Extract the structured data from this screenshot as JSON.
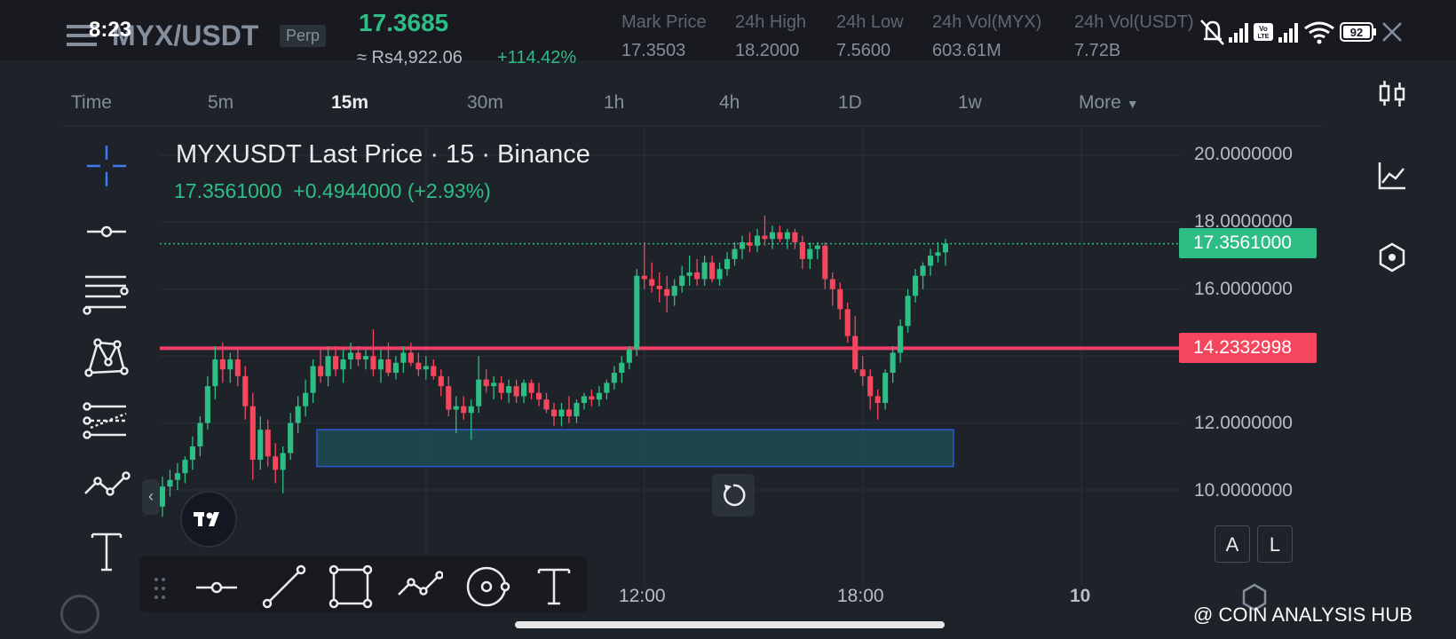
{
  "status_bar": {
    "time": "8:23",
    "battery": "92",
    "network_badge": "Vo LTE"
  },
  "header": {
    "pair": "MYX/USDT",
    "contract_type": "Perp",
    "last_price": "17.3685",
    "price_inr": "≈ Rs4,922.06",
    "change_24h": "+114.42%",
    "stats": [
      {
        "label": "Mark Price",
        "value": "17.3503"
      },
      {
        "label": "24h High",
        "value": "18.2000"
      },
      {
        "label": "24h Low",
        "value": "7.5600"
      },
      {
        "label": "24h Vol(MYX)",
        "value": "603.61M"
      },
      {
        "label": "24h Vol(USDT)",
        "value": "7.72B"
      }
    ]
  },
  "timeframes": {
    "items": [
      "Time",
      "5m",
      "15m",
      "30m",
      "1h",
      "4h",
      "1D",
      "1w",
      "More"
    ],
    "active": "15m"
  },
  "chart": {
    "title": "MYXUSDT Last Price · 15 · Binance",
    "last_value": "17.3561000",
    "change": "+0.4944000 (+2.93%)",
    "y_ticks": [
      "20.0000000",
      "18.0000000",
      "16.0000000",
      "12.0000000",
      "10.0000000"
    ],
    "x_ticks": [
      "12:00",
      "18:00",
      "10"
    ],
    "current_price_label": "17.3561000",
    "horizontal_line_label": "14.2332998",
    "scale_buttons": {
      "auto": "A",
      "log": "L"
    },
    "colors": {
      "up": "#2ebd85",
      "down": "#f6465d",
      "line": "#f23f6a",
      "zone": "#1f4a55",
      "zone_border": "#2c5bd6"
    }
  },
  "watermark": "@ COIN ANALYSIS HUB",
  "chart_data": {
    "type": "candlestick",
    "title": "MYXUSDT Last Price · 15 · Binance",
    "ylim": [
      9.0,
      20.5
    ],
    "horizontal_line": 14.2332998,
    "last_price": 17.3561,
    "zone": {
      "y_low": 10.7,
      "y_high": 11.8
    },
    "candles": [
      {
        "o": 9.5,
        "h": 10.4,
        "l": 9.2,
        "c": 10.1
      },
      {
        "o": 10.1,
        "h": 10.6,
        "l": 9.8,
        "c": 10.3
      },
      {
        "o": 10.3,
        "h": 10.8,
        "l": 10.0,
        "c": 10.5
      },
      {
        "o": 10.5,
        "h": 11.0,
        "l": 10.2,
        "c": 10.9
      },
      {
        "o": 10.9,
        "h": 11.6,
        "l": 10.6,
        "c": 11.3
      },
      {
        "o": 11.3,
        "h": 12.2,
        "l": 11.0,
        "c": 12.0
      },
      {
        "o": 12.0,
        "h": 13.4,
        "l": 11.8,
        "c": 13.1
      },
      {
        "o": 13.1,
        "h": 14.3,
        "l": 12.7,
        "c": 13.9
      },
      {
        "o": 13.9,
        "h": 14.4,
        "l": 13.2,
        "c": 13.6
      },
      {
        "o": 13.6,
        "h": 14.1,
        "l": 13.2,
        "c": 13.9
      },
      {
        "o": 13.9,
        "h": 14.2,
        "l": 13.1,
        "c": 13.4
      },
      {
        "o": 13.4,
        "h": 13.7,
        "l": 12.1,
        "c": 12.5
      },
      {
        "o": 12.5,
        "h": 12.9,
        "l": 10.3,
        "c": 10.9
      },
      {
        "o": 10.9,
        "h": 12.2,
        "l": 10.6,
        "c": 11.8
      },
      {
        "o": 11.8,
        "h": 12.1,
        "l": 10.7,
        "c": 11.0
      },
      {
        "o": 11.0,
        "h": 11.4,
        "l": 10.2,
        "c": 10.6
      },
      {
        "o": 10.6,
        "h": 11.3,
        "l": 9.9,
        "c": 11.1
      },
      {
        "o": 11.1,
        "h": 12.3,
        "l": 10.9,
        "c": 12.0
      },
      {
        "o": 12.0,
        "h": 12.8,
        "l": 11.7,
        "c": 12.5
      },
      {
        "o": 12.5,
        "h": 13.3,
        "l": 12.2,
        "c": 12.9
      },
      {
        "o": 12.9,
        "h": 13.9,
        "l": 12.6,
        "c": 13.7
      },
      {
        "o": 13.7,
        "h": 14.2,
        "l": 13.2,
        "c": 13.4
      },
      {
        "o": 13.4,
        "h": 14.3,
        "l": 13.1,
        "c": 14.0
      },
      {
        "o": 14.0,
        "h": 14.3,
        "l": 13.4,
        "c": 13.6
      },
      {
        "o": 13.6,
        "h": 14.2,
        "l": 13.2,
        "c": 13.9
      },
      {
        "o": 13.9,
        "h": 14.4,
        "l": 13.6,
        "c": 14.1
      },
      {
        "o": 14.1,
        "h": 14.3,
        "l": 13.7,
        "c": 13.9
      },
      {
        "o": 13.9,
        "h": 14.2,
        "l": 13.6,
        "c": 14.0
      },
      {
        "o": 14.0,
        "h": 14.8,
        "l": 13.4,
        "c": 13.6
      },
      {
        "o": 13.6,
        "h": 14.2,
        "l": 13.2,
        "c": 13.9
      },
      {
        "o": 13.9,
        "h": 14.4,
        "l": 13.4,
        "c": 13.5
      },
      {
        "o": 13.5,
        "h": 14.0,
        "l": 13.3,
        "c": 13.8
      },
      {
        "o": 13.8,
        "h": 14.3,
        "l": 13.5,
        "c": 14.1
      },
      {
        "o": 14.1,
        "h": 14.4,
        "l": 13.7,
        "c": 13.8
      },
      {
        "o": 13.8,
        "h": 14.1,
        "l": 13.4,
        "c": 13.6
      },
      {
        "o": 13.6,
        "h": 14.0,
        "l": 13.3,
        "c": 13.7
      },
      {
        "o": 13.7,
        "h": 13.9,
        "l": 13.3,
        "c": 13.4
      },
      {
        "o": 13.4,
        "h": 13.6,
        "l": 12.8,
        "c": 13.1
      },
      {
        "o": 13.1,
        "h": 13.4,
        "l": 12.2,
        "c": 12.4
      },
      {
        "o": 12.4,
        "h": 12.8,
        "l": 11.7,
        "c": 12.5
      },
      {
        "o": 12.5,
        "h": 12.8,
        "l": 12.1,
        "c": 12.3
      },
      {
        "o": 12.3,
        "h": 12.7,
        "l": 11.5,
        "c": 12.5
      },
      {
        "o": 12.5,
        "h": 14.0,
        "l": 12.3,
        "c": 13.3
      },
      {
        "o": 13.3,
        "h": 13.6,
        "l": 12.9,
        "c": 13.1
      },
      {
        "o": 13.1,
        "h": 13.4,
        "l": 12.7,
        "c": 13.2
      },
      {
        "o": 13.2,
        "h": 13.4,
        "l": 12.7,
        "c": 12.9
      },
      {
        "o": 12.9,
        "h": 13.3,
        "l": 12.6,
        "c": 13.1
      },
      {
        "o": 13.1,
        "h": 13.3,
        "l": 12.6,
        "c": 12.8
      },
      {
        "o": 12.8,
        "h": 13.3,
        "l": 12.6,
        "c": 13.2
      },
      {
        "o": 13.2,
        "h": 13.3,
        "l": 12.7,
        "c": 12.9
      },
      {
        "o": 12.9,
        "h": 13.2,
        "l": 12.5,
        "c": 12.7
      },
      {
        "o": 12.7,
        "h": 12.9,
        "l": 12.3,
        "c": 12.4
      },
      {
        "o": 12.4,
        "h": 12.6,
        "l": 11.9,
        "c": 12.2
      },
      {
        "o": 12.2,
        "h": 12.6,
        "l": 11.9,
        "c": 12.4
      },
      {
        "o": 12.4,
        "h": 12.8,
        "l": 12.0,
        "c": 12.2
      },
      {
        "o": 12.2,
        "h": 12.7,
        "l": 12.0,
        "c": 12.6
      },
      {
        "o": 12.6,
        "h": 12.9,
        "l": 12.4,
        "c": 12.8
      },
      {
        "o": 12.8,
        "h": 13.0,
        "l": 12.5,
        "c": 12.7
      },
      {
        "o": 12.7,
        "h": 13.1,
        "l": 12.5,
        "c": 12.9
      },
      {
        "o": 12.9,
        "h": 13.3,
        "l": 12.7,
        "c": 13.2
      },
      {
        "o": 13.2,
        "h": 13.7,
        "l": 13.0,
        "c": 13.5
      },
      {
        "o": 13.5,
        "h": 14.0,
        "l": 13.2,
        "c": 13.8
      },
      {
        "o": 13.8,
        "h": 14.3,
        "l": 13.6,
        "c": 14.2
      },
      {
        "o": 14.2,
        "h": 16.6,
        "l": 14.0,
        "c": 16.4
      },
      {
        "o": 16.4,
        "h": 17.4,
        "l": 16.0,
        "c": 16.3
      },
      {
        "o": 16.3,
        "h": 16.8,
        "l": 15.9,
        "c": 16.1
      },
      {
        "o": 16.1,
        "h": 16.5,
        "l": 15.6,
        "c": 16.0
      },
      {
        "o": 16.0,
        "h": 16.4,
        "l": 15.3,
        "c": 15.8
      },
      {
        "o": 15.8,
        "h": 16.3,
        "l": 15.5,
        "c": 16.1
      },
      {
        "o": 16.1,
        "h": 16.7,
        "l": 15.9,
        "c": 16.4
      },
      {
        "o": 16.4,
        "h": 17.0,
        "l": 16.1,
        "c": 16.5
      },
      {
        "o": 16.5,
        "h": 16.9,
        "l": 16.1,
        "c": 16.3
      },
      {
        "o": 16.3,
        "h": 17.0,
        "l": 16.1,
        "c": 16.8
      },
      {
        "o": 16.8,
        "h": 17.0,
        "l": 16.2,
        "c": 16.3
      },
      {
        "o": 16.3,
        "h": 16.8,
        "l": 16.1,
        "c": 16.6
      },
      {
        "o": 16.6,
        "h": 17.1,
        "l": 16.4,
        "c": 16.9
      },
      {
        "o": 16.9,
        "h": 17.4,
        "l": 16.7,
        "c": 17.2
      },
      {
        "o": 17.2,
        "h": 17.6,
        "l": 16.9,
        "c": 17.4
      },
      {
        "o": 17.4,
        "h": 17.7,
        "l": 17.1,
        "c": 17.3
      },
      {
        "o": 17.3,
        "h": 17.8,
        "l": 17.1,
        "c": 17.6
      },
      {
        "o": 17.6,
        "h": 18.2,
        "l": 17.3,
        "c": 17.5
      },
      {
        "o": 17.5,
        "h": 17.9,
        "l": 17.2,
        "c": 17.7
      },
      {
        "o": 17.7,
        "h": 17.9,
        "l": 17.4,
        "c": 17.5
      },
      {
        "o": 17.5,
        "h": 17.8,
        "l": 17.2,
        "c": 17.7
      },
      {
        "o": 17.7,
        "h": 17.8,
        "l": 17.2,
        "c": 17.4
      },
      {
        "o": 17.4,
        "h": 17.6,
        "l": 16.6,
        "c": 16.9
      },
      {
        "o": 16.9,
        "h": 17.4,
        "l": 16.6,
        "c": 17.2
      },
      {
        "o": 17.2,
        "h": 17.4,
        "l": 16.9,
        "c": 17.3
      },
      {
        "o": 17.3,
        "h": 17.4,
        "l": 16.0,
        "c": 16.3
      },
      {
        "o": 16.3,
        "h": 16.5,
        "l": 15.5,
        "c": 16.0
      },
      {
        "o": 16.0,
        "h": 16.2,
        "l": 15.1,
        "c": 15.4
      },
      {
        "o": 15.4,
        "h": 15.6,
        "l": 14.4,
        "c": 14.6
      },
      {
        "o": 14.6,
        "h": 15.2,
        "l": 13.5,
        "c": 13.6
      },
      {
        "o": 13.6,
        "h": 14.0,
        "l": 13.1,
        "c": 13.4
      },
      {
        "o": 13.4,
        "h": 13.6,
        "l": 12.4,
        "c": 12.8
      },
      {
        "o": 12.8,
        "h": 13.0,
        "l": 12.1,
        "c": 12.6
      },
      {
        "o": 12.6,
        "h": 13.6,
        "l": 12.4,
        "c": 13.5
      },
      {
        "o": 13.5,
        "h": 14.3,
        "l": 13.2,
        "c": 14.1
      },
      {
        "o": 14.1,
        "h": 15.1,
        "l": 13.8,
        "c": 14.9
      },
      {
        "o": 14.9,
        "h": 16.0,
        "l": 14.7,
        "c": 15.8
      },
      {
        "o": 15.8,
        "h": 16.6,
        "l": 15.6,
        "c": 16.4
      },
      {
        "o": 16.4,
        "h": 16.8,
        "l": 16.0,
        "c": 16.7
      },
      {
        "o": 16.7,
        "h": 17.2,
        "l": 16.4,
        "c": 17.0
      },
      {
        "o": 17.0,
        "h": 17.4,
        "l": 16.8,
        "c": 17.1
      },
      {
        "o": 17.1,
        "h": 17.5,
        "l": 16.7,
        "c": 17.36
      }
    ]
  }
}
